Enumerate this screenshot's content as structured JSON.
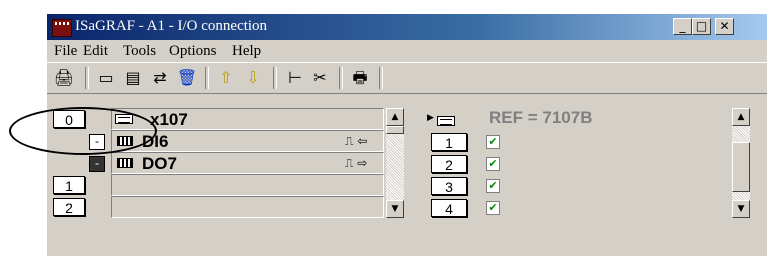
{
  "window": {
    "title": "ISaGRAF - A1 - I/O connection",
    "controls": {
      "minimize": "_",
      "maximize": "□",
      "close": "✕"
    }
  },
  "menu": [
    "File",
    "Edit",
    "Tools",
    "Options",
    "Help"
  ],
  "toolbar": {
    "icons": [
      "open-icon",
      "io-board-icon",
      "io-list-icon",
      "connect-icon",
      "delete-icon",
      "move-up-icon",
      "move-down-icon",
      "tree-icon",
      "cut-icon",
      "print-icon"
    ],
    "arrow_color": "#ffff00"
  },
  "left_panel": {
    "rows": [
      {
        "slot": "0",
        "label": "x107",
        "icon": "board-icon",
        "expander": ""
      },
      {
        "expander": "-",
        "label": "DI6",
        "icon": "device-icon",
        "signal": "⎍ ⇦"
      },
      {
        "expander": "-",
        "label": "DO7",
        "icon": "device-icon",
        "signal": "⎍ ⇨",
        "selected": true
      },
      {
        "slot": "1",
        "label": ""
      },
      {
        "slot": "2",
        "label": ""
      }
    ]
  },
  "right_panel": {
    "header": "REF = 7107B",
    "header_color": "#808080",
    "channels": [
      "1",
      "2",
      "3",
      "4"
    ],
    "check_color": "#0a8a0a"
  },
  "annotation": {
    "type": "ellipse",
    "target": "slot 0"
  }
}
